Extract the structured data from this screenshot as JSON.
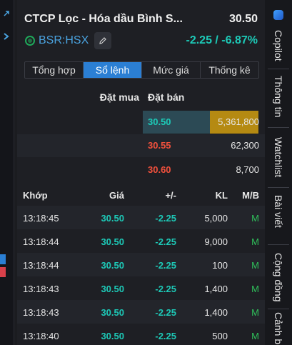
{
  "header": {
    "title": "CTCP Lọc - Hóa dầu Bình S...",
    "price": "30.50",
    "symbol": "BSR:HSX",
    "change": "-2.25 / -6.87%"
  },
  "tabs": [
    {
      "label": "Tổng hợp",
      "active": false
    },
    {
      "label": "Sổ lệnh",
      "active": true
    },
    {
      "label": "Mức giá",
      "active": false
    },
    {
      "label": "Thống kê",
      "active": false
    }
  ],
  "orderbook": {
    "buy_label": "Đặt mua",
    "sell_label": "Đặt bán",
    "rows": [
      {
        "price": "30.50",
        "qty": "5,361,800",
        "color": "#1dc9b7"
      },
      {
        "price": "30.55",
        "qty": "62,300",
        "color": "#f0503c"
      },
      {
        "price": "30.60",
        "qty": "8,700",
        "color": "#f0503c"
      }
    ]
  },
  "trades": {
    "headers": {
      "time": "Khớp",
      "price": "Giá",
      "change": "+/-",
      "volume": "KL",
      "side": "M/B"
    },
    "rows": [
      {
        "time": "13:18:45",
        "price": "30.50",
        "change": "-2.25",
        "volume": "5,000",
        "side": "M"
      },
      {
        "time": "13:18:44",
        "price": "30.50",
        "change": "-2.25",
        "volume": "9,000",
        "side": "M"
      },
      {
        "time": "13:18:44",
        "price": "30.50",
        "change": "-2.25",
        "volume": "100",
        "side": "M"
      },
      {
        "time": "13:18:43",
        "price": "30.50",
        "change": "-2.25",
        "volume": "1,400",
        "side": "M"
      },
      {
        "time": "13:18:43",
        "price": "30.50",
        "change": "-2.25",
        "volume": "1,400",
        "side": "M"
      },
      {
        "time": "13:18:40",
        "price": "30.50",
        "change": "-2.25",
        "volume": "500",
        "side": "M"
      }
    ]
  },
  "right_tabs": [
    "Copilot",
    "Thông tin",
    "Watchlist",
    "Bài viết",
    "Cộng đồng",
    "Cảnh b"
  ],
  "colors": {
    "accent": "#2b7fd4",
    "down": "#1dc9b7",
    "up_red": "#f0503c",
    "buy_green": "#2fbf5a",
    "highlight": "#b58a12"
  }
}
